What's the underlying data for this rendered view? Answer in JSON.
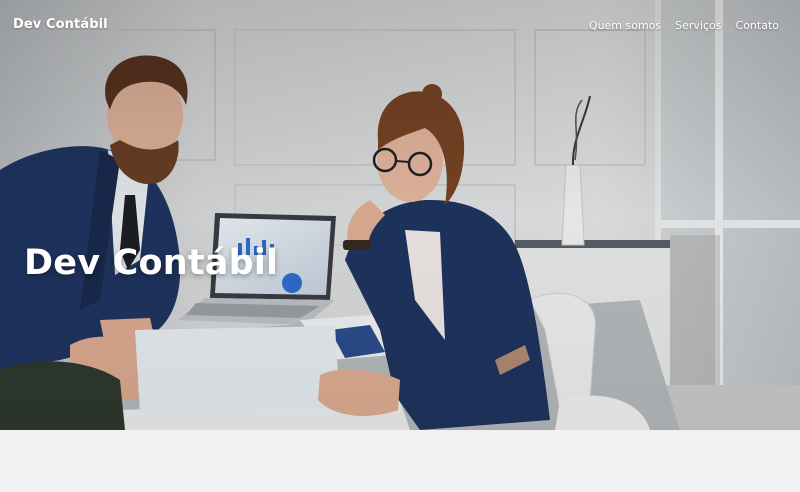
{
  "navbar": {
    "brand": "Dev Contábil",
    "links": [
      {
        "label": "Quem somos"
      },
      {
        "label": "Serviços"
      },
      {
        "label": "Contato"
      }
    ]
  },
  "hero": {
    "title": "Dev Contábil",
    "image_description": "two-business-people-reviewing-documents-in-office"
  },
  "colors": {
    "nav_text": "#ffffff",
    "below_section_bg": "#f1f1f1",
    "wall": "#d9dbdc",
    "suit_navy": "#1f3561"
  }
}
